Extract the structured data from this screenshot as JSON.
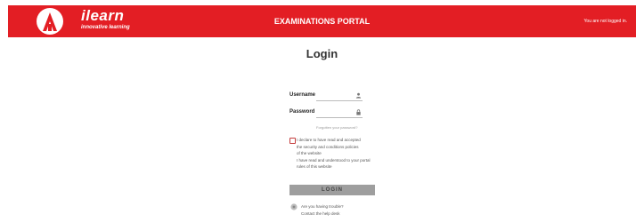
{
  "colors": {
    "brand_red": "#e31e24",
    "button_gray": "#9e9e9e",
    "text_dark": "#333333"
  },
  "header": {
    "logo_icon": "ilearn-logo-icon",
    "brand": "ilearn",
    "tagline": "innovative learning",
    "title": "EXAMINATIONS PORTAL",
    "status": "You are not logged in."
  },
  "login": {
    "heading": "Login",
    "username_label": "Username",
    "username_value": "",
    "username_icon": "user-icon",
    "password_label": "Password",
    "password_value": "",
    "password_icon": "lock-icon",
    "forgot_link": "Forgotten your password?",
    "agree_lines": [
      "I declare to have read and accepted",
      "the security and conditions policies",
      "of the website",
      "I have read and understood to your portal",
      "rules of this website"
    ],
    "submit_label": "LOGIN",
    "help_icon": "help-icon",
    "help_lines": [
      "Are you having trouble?",
      "Contact the help desk"
    ]
  }
}
